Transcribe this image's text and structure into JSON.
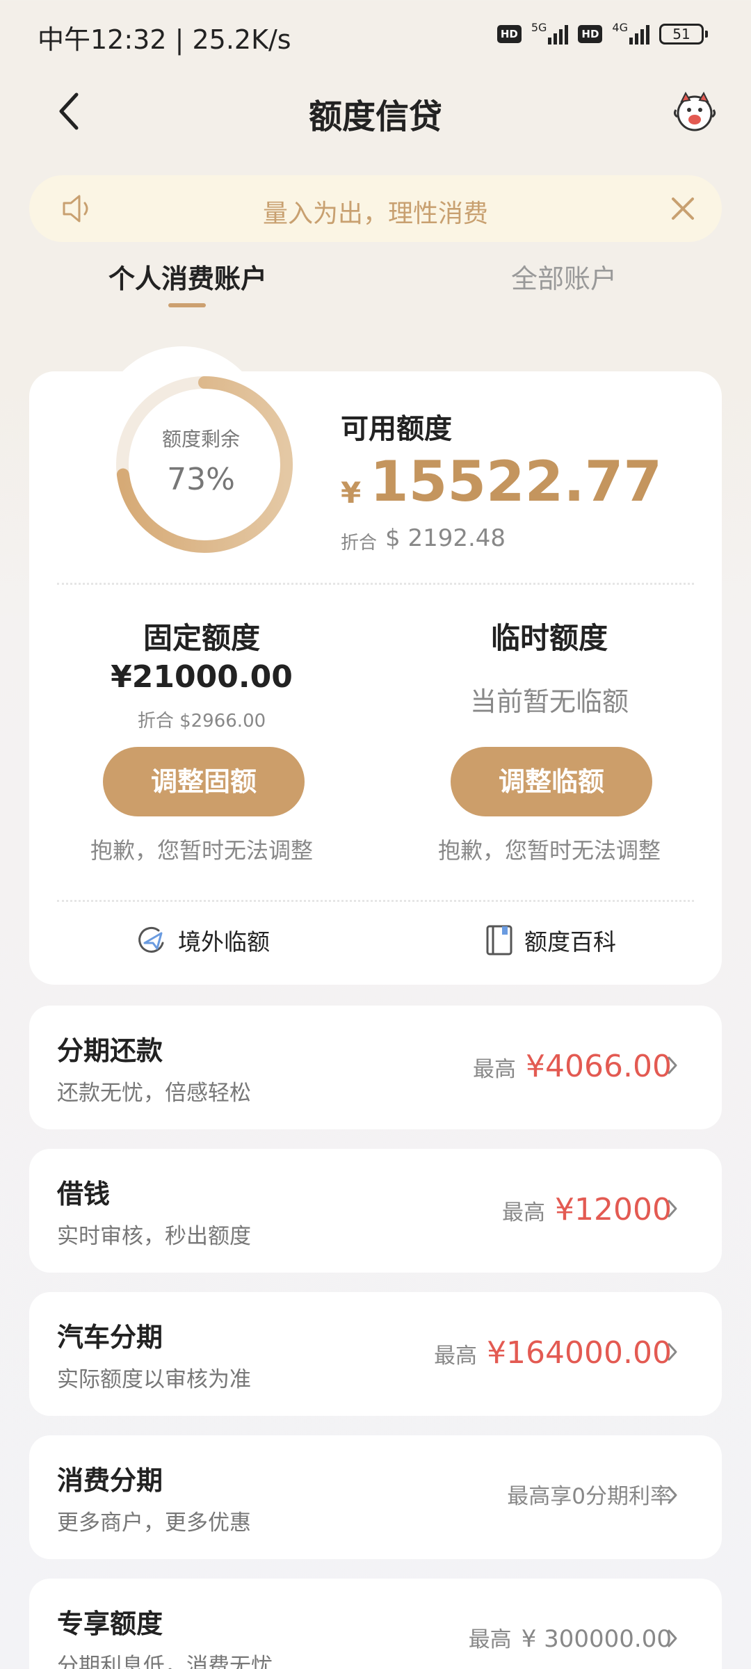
{
  "status": {
    "time_speed": "中午12:32 | 25.2K/s",
    "hd": "HD",
    "net1": "5G",
    "net2": "4G",
    "battery": "51"
  },
  "nav": {
    "title": "额度信贷",
    "back_icon": "chevron-left-icon",
    "mascot_icon": "mascot-icon"
  },
  "notice": {
    "text": "量入为出，理性消费",
    "speaker_icon": "speaker-icon",
    "close_icon": "close-icon"
  },
  "tabs": [
    {
      "label": "个人消费账户",
      "active": true
    },
    {
      "label": "全部账户",
      "active": false
    }
  ],
  "summary": {
    "ring_label": "额度剩余",
    "ring_value": "73%",
    "ring_fraction": 0.73,
    "available_label": "可用额度",
    "currency": "¥",
    "available_amount": "15522.77",
    "converted_label": "折合",
    "converted_value": "$ 2192.48"
  },
  "fixed": {
    "title": "固定额度",
    "amount": "¥21000.00",
    "converted": "折合 $2966.00",
    "button": "调整固额",
    "note": "抱歉，您暂时无法调整"
  },
  "temporary": {
    "title": "临时额度",
    "status": "当前暂无临额",
    "button": "调整临额",
    "note": "抱歉，您暂时无法调整"
  },
  "utilities": [
    {
      "label": "境外临额",
      "icon": "plane-icon"
    },
    {
      "label": "额度百科",
      "icon": "book-icon"
    }
  ],
  "list": [
    {
      "title": "分期还款",
      "subtitle": "还款无忧，倍感轻松",
      "prefix": "最高",
      "amount": "¥4066.00"
    },
    {
      "title": "借钱",
      "subtitle": "实时审核，秒出额度",
      "prefix": "最高",
      "amount": "¥12000"
    },
    {
      "title": "汽车分期",
      "subtitle": "实际额度以审核为准",
      "prefix": "最高",
      "amount": "¥164000.00"
    },
    {
      "title": "消费分期",
      "subtitle": "更多商户，更多优惠",
      "rate": "最高享0分期利率"
    },
    {
      "title": "专享额度",
      "subtitle": "分期利息低，消费无忧",
      "prefix": "最高",
      "amount": "¥ 300000.00"
    }
  ],
  "colors": {
    "accent": "#cc9e6a",
    "red": "#e35a52",
    "notice_bg": "#fbf5e4"
  }
}
